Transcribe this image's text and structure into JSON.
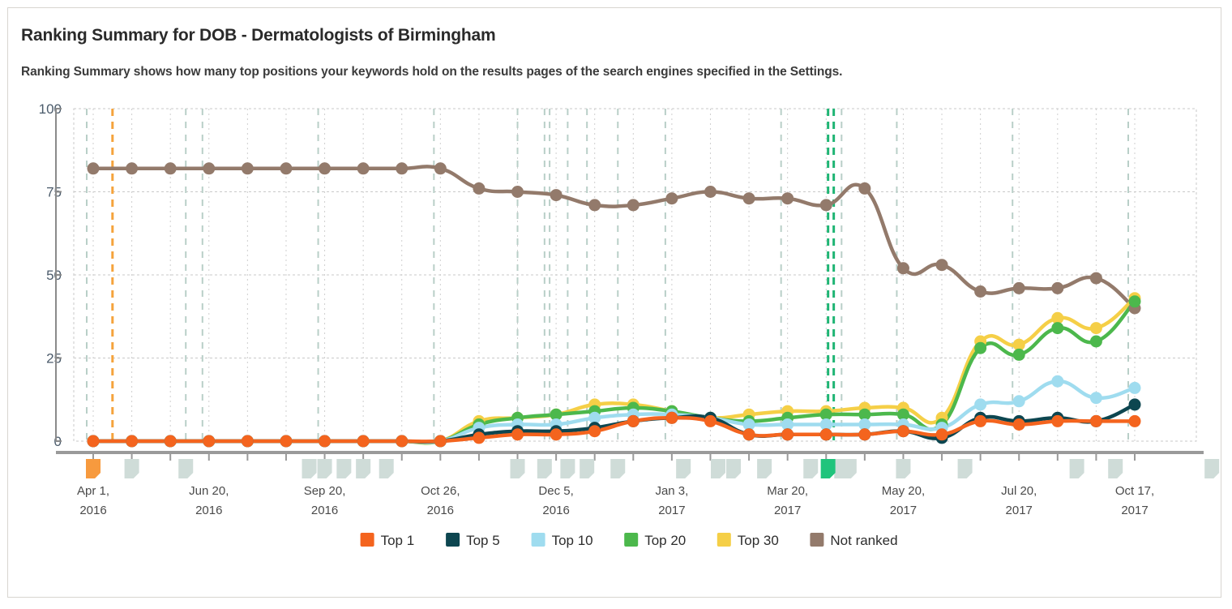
{
  "card": {
    "title": "Ranking Summary for DOB - Dermatologists of Birmingham",
    "subtitle": "Ranking Summary shows how many top positions your keywords hold on the results pages of the search engines specified in the Settings."
  },
  "chart_data": {
    "type": "line",
    "title": "Ranking Summary for DOB - Dermatologists of Birmingham",
    "xlabel": "",
    "ylabel": "",
    "ylim": [
      0,
      100
    ],
    "yticks": [
      0,
      25,
      50,
      75,
      100
    ],
    "grid": true,
    "legend_position": "bottom",
    "xtick_labels": [
      {
        "line1": "Apr 1,",
        "line2": "2016",
        "index": 0
      },
      {
        "line1": "Jun 20,",
        "line2": "2016",
        "index": 3
      },
      {
        "line1": "Sep 20,",
        "line2": "2016",
        "index": 6
      },
      {
        "line1": "Oct 26,",
        "line2": "2016",
        "index": 9
      },
      {
        "line1": "Dec 5,",
        "line2": "2016",
        "index": 12
      },
      {
        "line1": "Jan 3,",
        "line2": "2017",
        "index": 15
      },
      {
        "line1": "Mar 20,",
        "line2": "2017",
        "index": 18
      },
      {
        "line1": "May 20,",
        "line2": "2017",
        "index": 21
      },
      {
        "line1": "Jul 20,",
        "line2": "2017",
        "index": 24
      },
      {
        "line1": "Oct 17,",
        "line2": "2017",
        "index": 27
      }
    ],
    "x_count": 28,
    "series": [
      {
        "name": "Top 1",
        "color": "#f4641e",
        "values": [
          0,
          0,
          0,
          0,
          0,
          0,
          0,
          0,
          0,
          0,
          1,
          2,
          2,
          3,
          6,
          7,
          6,
          2,
          2,
          2,
          2,
          3,
          2,
          6,
          5,
          6,
          6,
          6
        ]
      },
      {
        "name": "Top 5",
        "color": "#0d4650",
        "values": [
          0,
          0,
          0,
          0,
          0,
          0,
          0,
          0,
          0,
          0,
          2,
          3,
          3,
          4,
          6,
          7,
          7,
          2,
          2,
          2,
          2,
          3,
          1,
          7,
          6,
          7,
          6,
          11
        ]
      },
      {
        "name": "Top 10",
        "color": "#9fdcef",
        "values": [
          0,
          0,
          0,
          0,
          0,
          0,
          0,
          0,
          0,
          0,
          4,
          5,
          5,
          7,
          8,
          8,
          7,
          5,
          5,
          5,
          5,
          5,
          4,
          11,
          12,
          18,
          13,
          16
        ]
      },
      {
        "name": "Top 20",
        "color": "#4cb84c",
        "values": [
          0,
          0,
          0,
          0,
          0,
          0,
          0,
          0,
          0,
          0,
          5,
          7,
          8,
          9,
          10,
          9,
          7,
          6,
          7,
          8,
          8,
          8,
          5,
          28,
          26,
          34,
          30,
          42
        ]
      },
      {
        "name": "Top 30",
        "color": "#f5cf47",
        "values": [
          0,
          0,
          0,
          0,
          0,
          0,
          0,
          0,
          0,
          0,
          6,
          7,
          8,
          11,
          11,
          9,
          7,
          8,
          9,
          9,
          10,
          10,
          7,
          30,
          29,
          37,
          34,
          43
        ]
      },
      {
        "name": "Not ranked",
        "color": "#937a6b",
        "values": [
          82,
          82,
          82,
          82,
          82,
          82,
          82,
          82,
          82,
          82,
          76,
          75,
          74,
          71,
          71,
          73,
          75,
          73,
          73,
          71,
          76,
          52,
          53,
          45,
          46,
          46,
          49,
          40
        ]
      }
    ],
    "markers": [
      {
        "index": 0,
        "color": "orange"
      },
      {
        "index": 2.4,
        "color": "grey"
      },
      {
        "index": 11.0,
        "color": "grey"
      },
      {
        "index": 11.7,
        "color": "grey"
      },
      {
        "index": 12.3,
        "color": "grey"
      },
      {
        "index": 12.8,
        "color": "grey"
      },
      {
        "index": 13.6,
        "color": "grey"
      },
      {
        "index": 19.4,
        "color": "grey"
      },
      {
        "index": 29.0,
        "color": "grey"
      }
    ],
    "vline_highlight": {
      "orange_index": 0.5,
      "green_index": 19.05
    }
  },
  "legend": {
    "items": [
      {
        "label": "Top 1",
        "color": "#f4641e"
      },
      {
        "label": "Top 5",
        "color": "#0d4650"
      },
      {
        "label": "Top 10",
        "color": "#9fdcef"
      },
      {
        "label": "Top 20",
        "color": "#4cb84c"
      },
      {
        "label": "Top 30",
        "color": "#f5cf47"
      },
      {
        "label": "Not ranked",
        "color": "#937a6b"
      }
    ]
  },
  "axis": {
    "y_tick_labels": [
      "100",
      "75",
      "50",
      "25",
      "0"
    ]
  }
}
